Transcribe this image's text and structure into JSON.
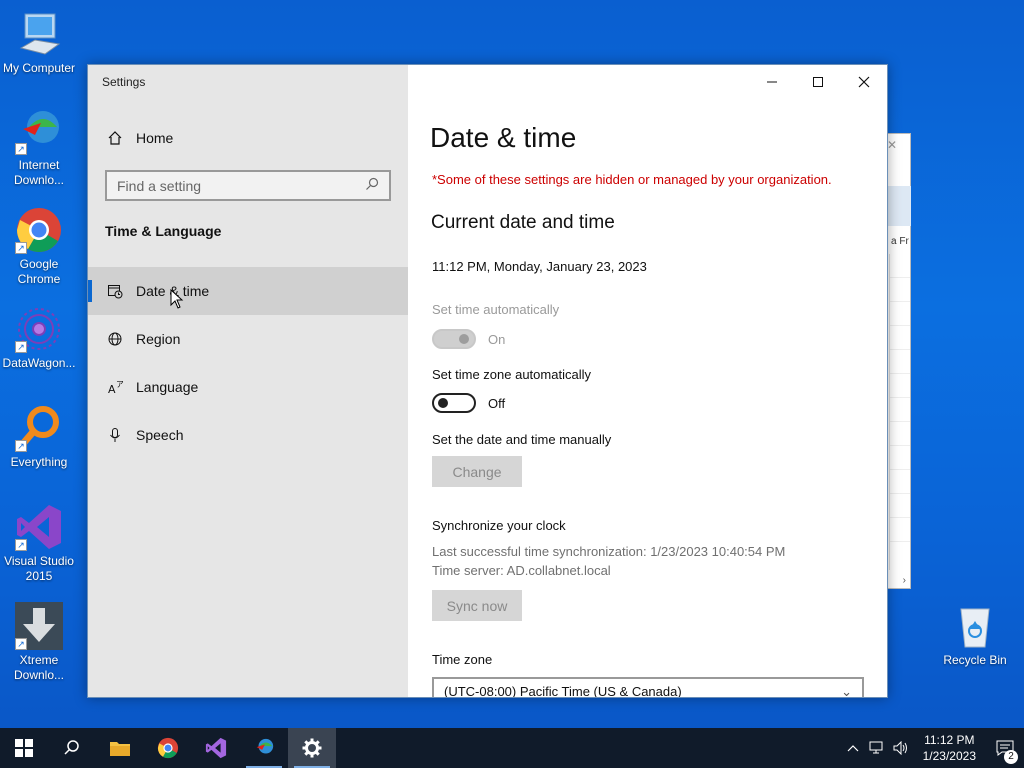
{
  "desktop": {
    "icons": [
      {
        "label": "My Computer"
      },
      {
        "label": "Internet Downlo..."
      },
      {
        "label": "Google Chrome"
      },
      {
        "label": "DataWagon..."
      },
      {
        "label": "Everything"
      },
      {
        "label": "Visual Studio 2015"
      },
      {
        "label": "Xtreme Downlo..."
      }
    ],
    "recycle_bin": "Recycle Bin",
    "background_window_fragment": "a Fr"
  },
  "window": {
    "title": "Settings",
    "caption": {
      "minimize": "—",
      "maximize": "☐",
      "close": "✕"
    }
  },
  "sidebar": {
    "home_label": "Home",
    "search_placeholder": "Find a setting",
    "section_label": "Time & Language",
    "items": [
      {
        "label": "Date & time",
        "active": true
      },
      {
        "label": "Region"
      },
      {
        "label": "Language"
      },
      {
        "label": "Speech"
      }
    ]
  },
  "main": {
    "title": "Date & time",
    "org_notice": "*Some of these settings are hidden or managed by your organization.",
    "section_title": "Current date and time",
    "current_datetime": "11:12 PM, Monday, January 23, 2023",
    "set_time_auto": {
      "label": "Set time automatically",
      "state": "On"
    },
    "set_timezone_auto": {
      "label": "Set time zone automatically",
      "state": "Off"
    },
    "manual": {
      "label": "Set the date and time manually",
      "button": "Change"
    },
    "sync": {
      "title": "Synchronize your clock",
      "last_sync": "Last successful time synchronization: 1/23/2023 10:40:54 PM",
      "server": "Time server: AD.collabnet.local",
      "button": "Sync now"
    },
    "timezone": {
      "label": "Time zone",
      "value": "(UTC-08:00) Pacific Time (US & Canada)"
    }
  },
  "taskbar": {
    "time": "11:12 PM",
    "date": "1/23/2023",
    "notification_count": "2"
  },
  "colors": {
    "accent": "#0a67d0",
    "warning": "#cc0000"
  }
}
